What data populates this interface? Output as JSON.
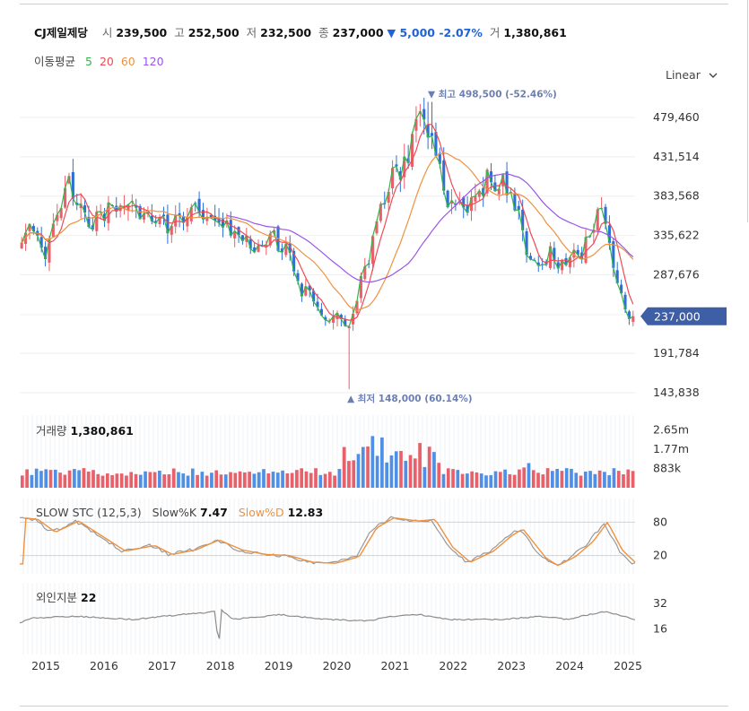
{
  "header": {
    "name": "CJ제일제당",
    "open_label": "시",
    "open": "239,500",
    "high_label": "고",
    "high": "252,500",
    "low_label": "저",
    "low": "232,500",
    "close_label": "종",
    "close": "237,000",
    "change": "▼ 5,000 -2.07%",
    "volume_label": "거",
    "volume": "1,380,861"
  },
  "ma_legend": {
    "label": "이동평균",
    "periods": [
      "5",
      "20",
      "60",
      "120"
    ],
    "colors": [
      "#33b54a",
      "#ee4b55",
      "#f0913e",
      "#9a55e6"
    ]
  },
  "scale_selector": {
    "label": "Linear",
    "icon": "chevron-down-icon"
  },
  "colors": {
    "up": "#e8606a",
    "down": "#2d6fd6",
    "price_tag": "#3e5fa6",
    "annotation": "#6c7fb3"
  },
  "chart_data": [
    {
      "type": "candlestick",
      "title": "",
      "x_ticks": [
        "2015",
        "2016",
        "2017",
        "2018",
        "2019",
        "2020",
        "2021",
        "2022",
        "2023",
        "2024",
        "2025"
      ],
      "y_ticks": [
        479460,
        431514,
        383568,
        335622,
        287676,
        191784,
        143838
      ],
      "ylim": [
        143838,
        503000
      ],
      "current_price": 237000,
      "current_price_label": "237,000",
      "max_annotation": {
        "year": 2021.58,
        "value": 498500,
        "label": "▼ 최고 498,500 (-52.46%)"
      },
      "min_annotation": {
        "year": 2020.2,
        "value": 148000,
        "label": "▲ 최저 148,000 (60.14%)"
      },
      "close_series": [
        [
          2014.55,
          322000
        ],
        [
          2014.75,
          345000
        ],
        [
          2014.95,
          300000
        ],
        [
          2015.15,
          352000
        ],
        [
          2015.35,
          402000
        ],
        [
          2015.55,
          378000
        ],
        [
          2015.75,
          352000
        ],
        [
          2015.95,
          362000
        ],
        [
          2016.15,
          372000
        ],
        [
          2016.35,
          378000
        ],
        [
          2016.6,
          358000
        ],
        [
          2016.85,
          352000
        ],
        [
          2017.1,
          348000
        ],
        [
          2017.35,
          366000
        ],
        [
          2017.6,
          362000
        ],
        [
          2017.85,
          368000
        ],
        [
          2018.1,
          342000
        ],
        [
          2018.35,
          330000
        ],
        [
          2018.6,
          324000
        ],
        [
          2018.85,
          332000
        ],
        [
          2019.1,
          318000
        ],
        [
          2019.3,
          278000
        ],
        [
          2019.55,
          258000
        ],
        [
          2019.8,
          236000
        ],
        [
          2020.0,
          242000
        ],
        [
          2020.15,
          226000
        ],
        [
          2020.3,
          256000
        ],
        [
          2020.5,
          298000
        ],
        [
          2020.65,
          362000
        ],
        [
          2020.85,
          398000
        ],
        [
          2021.05,
          408000
        ],
        [
          2021.25,
          442000
        ],
        [
          2021.4,
          478000
        ],
        [
          2021.55,
          458000
        ],
        [
          2021.75,
          412000
        ],
        [
          2021.95,
          372000
        ],
        [
          2022.15,
          368000
        ],
        [
          2022.35,
          388000
        ],
        [
          2022.55,
          402000
        ],
        [
          2022.75,
          406000
        ],
        [
          2022.95,
          392000
        ],
        [
          2023.1,
          355000
        ],
        [
          2023.25,
          320000
        ],
        [
          2023.45,
          293000
        ],
        [
          2023.6,
          312000
        ],
        [
          2023.8,
          305000
        ],
        [
          2024.0,
          315000
        ],
        [
          2024.2,
          310000
        ],
        [
          2024.4,
          355000
        ],
        [
          2024.55,
          378000
        ],
        [
          2024.7,
          315000
        ],
        [
          2024.85,
          268000
        ],
        [
          2024.98,
          248000
        ],
        [
          2025.05,
          237000
        ]
      ]
    },
    {
      "type": "bar",
      "title": "거래량",
      "value_label": "1,380,861",
      "y_ticks": [
        "2.65m",
        "1.77m",
        "883k"
      ],
      "ylim": [
        0,
        3000000
      ]
    },
    {
      "type": "line",
      "title": "SLOW STC (12,5,3)",
      "series": [
        {
          "name": "Slow%K",
          "value_label": "7.47",
          "color": "#999999"
        },
        {
          "name": "Slow%D",
          "value_label": "12.83",
          "color": "#f0913e"
        }
      ],
      "y_ticks": [
        "80",
        "20"
      ],
      "ylim": [
        0,
        100
      ]
    },
    {
      "type": "line",
      "title": "외인지분",
      "value_label": "22",
      "y_ticks": [
        "32",
        "16"
      ],
      "ylim": [
        0,
        45
      ]
    }
  ]
}
